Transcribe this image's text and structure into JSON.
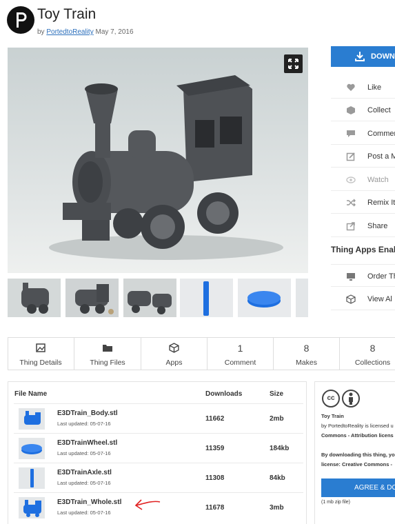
{
  "header": {
    "title": "Toy Train",
    "by_prefix": "by",
    "author": "PortedtoReality",
    "date": "May 7, 2016"
  },
  "side_actions": {
    "download_label": "DOWNL",
    "items": [
      {
        "label": "Like",
        "icon": "heart-icon"
      },
      {
        "label": "Collect",
        "icon": "collect-icon"
      },
      {
        "label": "Commen",
        "icon": "comment-icon"
      },
      {
        "label": "Post a M",
        "icon": "post-icon"
      },
      {
        "label": "Watch",
        "icon": "eye-icon"
      },
      {
        "label": "Remix It",
        "icon": "shuffle-icon"
      },
      {
        "label": "Share",
        "icon": "share-icon"
      }
    ],
    "apps_heading": "Thing Apps Enab",
    "app_items": [
      {
        "label": "Order Th",
        "icon": "monitor-icon"
      },
      {
        "label": "View Al",
        "icon": "cube-icon"
      }
    ]
  },
  "tabs": [
    {
      "top": "",
      "label": "Thing Details",
      "icon": "image-icon"
    },
    {
      "top": "",
      "label": "Thing Files",
      "icon": "folder-icon"
    },
    {
      "top": "",
      "label": "Apps",
      "icon": "cube-icon"
    },
    {
      "top": "1",
      "label": "Comment"
    },
    {
      "top": "8",
      "label": "Makes"
    },
    {
      "top": "8",
      "label": "Collections"
    }
  ],
  "files": {
    "headers": {
      "name": "File Name",
      "downloads": "Downloads",
      "size": "Size"
    },
    "date_prefix": "Last updated:",
    "rows": [
      {
        "name": "E3DTrain_Body.stl",
        "date": "05-07-16",
        "downloads": "11662",
        "size": "2mb"
      },
      {
        "name": "E3DTrainWheel.stl",
        "date": "05-07-16",
        "downloads": "11359",
        "size": "184kb"
      },
      {
        "name": "E3DTrainAxle.stl",
        "date": "05-07-16",
        "downloads": "11308",
        "size": "84kb"
      },
      {
        "name": "E3DTrain_Whole.stl",
        "date": "05-07-16",
        "downloads": "11678",
        "size": "3mb"
      }
    ]
  },
  "license": {
    "cc_text": "cc",
    "thing_name": "Toy Train",
    "line1": "by PortedtoReality is licensed u",
    "line2": "Commons - Attribution licens",
    "line3": "By downloading this thing, yo",
    "line4": "license: Creative Commons -",
    "agree_label": "AGREE & DO",
    "zip_note": "(1 mb zip file)"
  },
  "colors": {
    "accent": "#2a7dd1",
    "annotation_arrow": "#e02020",
    "model_blue": "#1e6fe0"
  }
}
